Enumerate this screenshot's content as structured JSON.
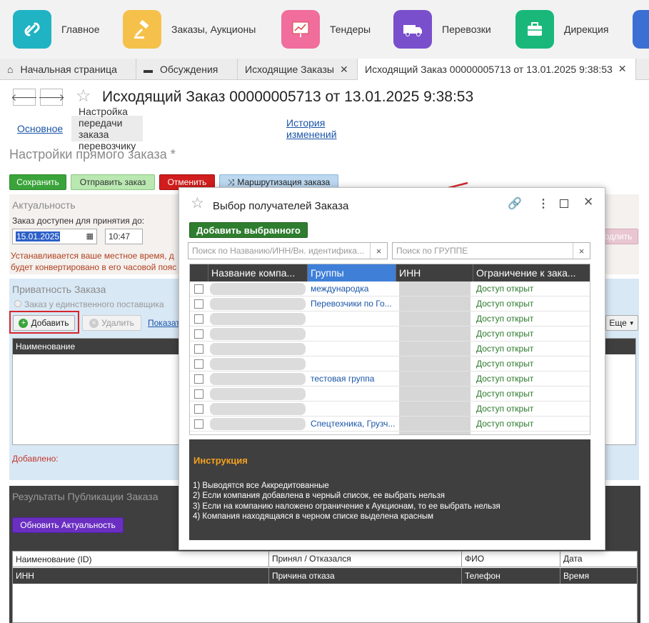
{
  "sections": [
    {
      "label": "Главное",
      "icon": "link-icon",
      "color": "#1fb3c4"
    },
    {
      "label": "Заказы, Аукционы",
      "icon": "gavel-icon",
      "color": "#f6c14b"
    },
    {
      "label": "Тендеры",
      "icon": "chart-icon",
      "color": "#f06d9c"
    },
    {
      "label": "Перевозки",
      "icon": "truck-icon",
      "color": "#7a4fcc"
    },
    {
      "label": "Дирекция",
      "icon": "briefcase-icon",
      "color": "#19b87a"
    }
  ],
  "tabs": [
    {
      "label": "Начальная страница"
    },
    {
      "label": "Обсуждения"
    },
    {
      "label": "Исходящие Заказы"
    },
    {
      "label": "Исходящий Заказ 00000005713 от 13.01.2025 9:38:53"
    }
  ],
  "header": {
    "title": "Исходящий Заказ 00000005713 от 13.01.2025 9:38:53"
  },
  "subtabs": [
    "Основное",
    "Настройка передачи заказа перевозчику",
    "История изменений"
  ],
  "page": {
    "heading": "Настройки прямого заказа *",
    "buttons": {
      "save": "Сохранить",
      "send": "Отправить заказ",
      "cancel": "Отменить",
      "routing": "Маршрутизация заказа",
      "add_partial": "одлить"
    }
  },
  "relevance": {
    "title": "Актуальность",
    "available_label": "Заказ доступен для принятия до:",
    "date": "15.01.2025",
    "time": "10:47",
    "warning_line1": "Устанавливается ваше местное время, д",
    "warning_line2": "будет конвертировано в его часовой пояс"
  },
  "privacy": {
    "title": "Приватность Заказа",
    "radio_label": "Заказ у единственного поставщика",
    "add_button": "Добавить",
    "delete_button": "Удалить",
    "show_link": "Показат",
    "more_button": "Еще",
    "col_name": "Наименование",
    "added_label": "Добавлено:"
  },
  "results": {
    "title": "Результаты Публикации Заказа",
    "refresh_button": "Обновить Актуальность",
    "row1": [
      "Наименование (ID)",
      "Принял / Отказался",
      "ФИО",
      "Дата"
    ],
    "row2": [
      "ИНН",
      "Причина отказа",
      "Телефон",
      "Время"
    ]
  },
  "modal": {
    "title": "Выбор получателей Заказа",
    "add_selected": "Добавить выбранного",
    "search_name_placeholder": "Поиск по Названию/ИНН/Вн. идентифика...",
    "search_group_placeholder": "Поиск по ГРУППЕ",
    "columns": [
      "Название компа...",
      "Группы",
      "ИНН",
      "Ограничение к зака..."
    ],
    "rows": [
      {
        "group": "международка",
        "limit": "Доступ открыт"
      },
      {
        "group": "Перевозчики по Го...",
        "limit": "Доступ открыт"
      },
      {
        "group": "",
        "limit": "Доступ открыт"
      },
      {
        "group": "",
        "limit": "Доступ открыт"
      },
      {
        "group": "",
        "limit": "Доступ открыт"
      },
      {
        "group": "",
        "limit": "Доступ открыт"
      },
      {
        "group": "тестовая группа",
        "limit": "Доступ открыт"
      },
      {
        "group": "",
        "limit": "Доступ открыт"
      },
      {
        "group": "",
        "limit": "Доступ открыт"
      },
      {
        "group": "Спецтехника, Грузч...",
        "limit": "Доступ открыт"
      }
    ],
    "instruction": {
      "title": "Инструкция",
      "lines": [
        "1) Выводятся все Аккредитованные",
        "2) Если компания добавлена в черный список, ее выбрать нельзя",
        "3) Если на компанию наложено ограничение к Аукционам, то ее выбрать нельзя",
        "4) Компания находящаяся в черном списке выделена красным"
      ]
    }
  }
}
